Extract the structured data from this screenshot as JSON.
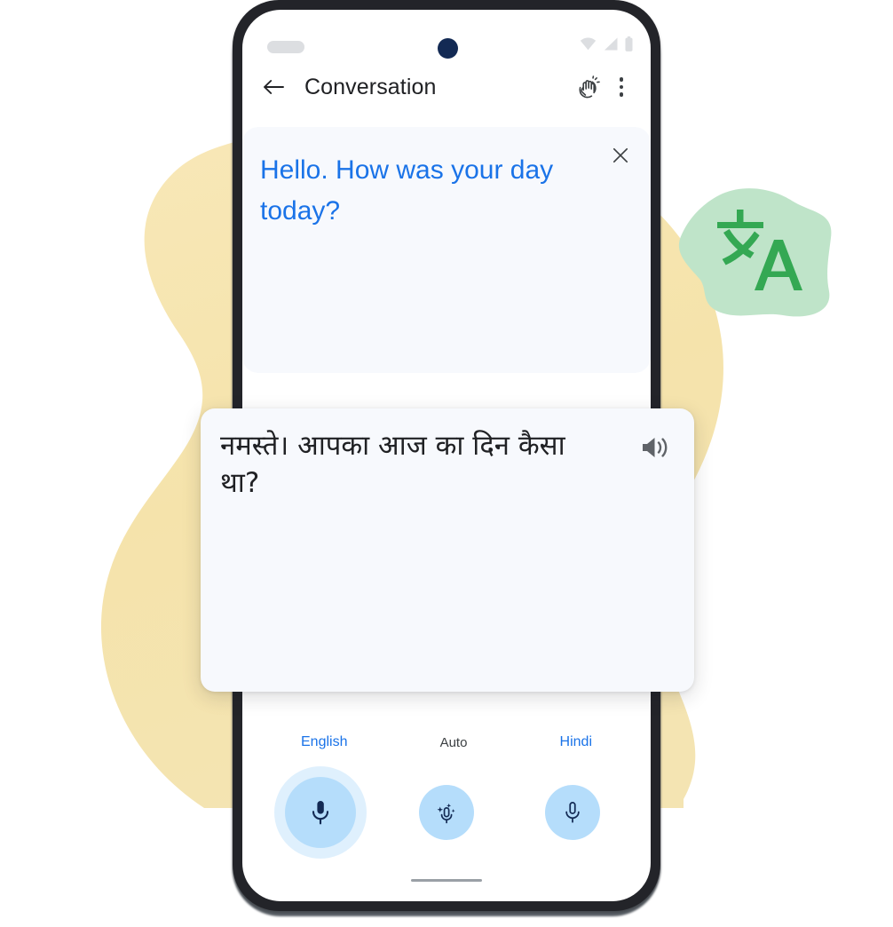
{
  "app": {
    "title": "Conversation"
  },
  "statusbar": {
    "pill_label": "",
    "icons": [
      "wifi-icon",
      "signal-icon",
      "battery-icon"
    ],
    "camera": "front-camera-dot"
  },
  "appbar": {
    "back_icon": "back-arrow-icon",
    "title": "Conversation",
    "wave_icon": "waving-hand-icon",
    "more_icon": "more-vertical-icon"
  },
  "source_panel": {
    "text": "Hello. How was your day today?",
    "close_icon": "close-icon",
    "text_color": "#1a73e8",
    "background": "#f7f9fd"
  },
  "target_card": {
    "text": "नमस्ते। आपका आज का दिन कैसा था?",
    "speaker_icon": "volume-up-icon",
    "background": "#f7f9fd"
  },
  "controls": {
    "languages": [
      {
        "label": "English",
        "mic": "mic-icon",
        "active": true
      },
      {
        "label": "Auto",
        "mic": "auto-mic-icon",
        "active": false
      },
      {
        "label": "Hindi",
        "mic": "mic-icon",
        "active": false
      }
    ],
    "accent_color": "#1a73e8",
    "mic_fill": "#b5ddfb",
    "mic_halo": "#dff0fd",
    "home_indicator": "home-indicator"
  },
  "decoration": {
    "yellow_blob_color": "#f7e7b4",
    "green_blob_color": "#bfe4c9",
    "translate_icon": "translate-icon",
    "translate_icon_color": "#34a853"
  }
}
